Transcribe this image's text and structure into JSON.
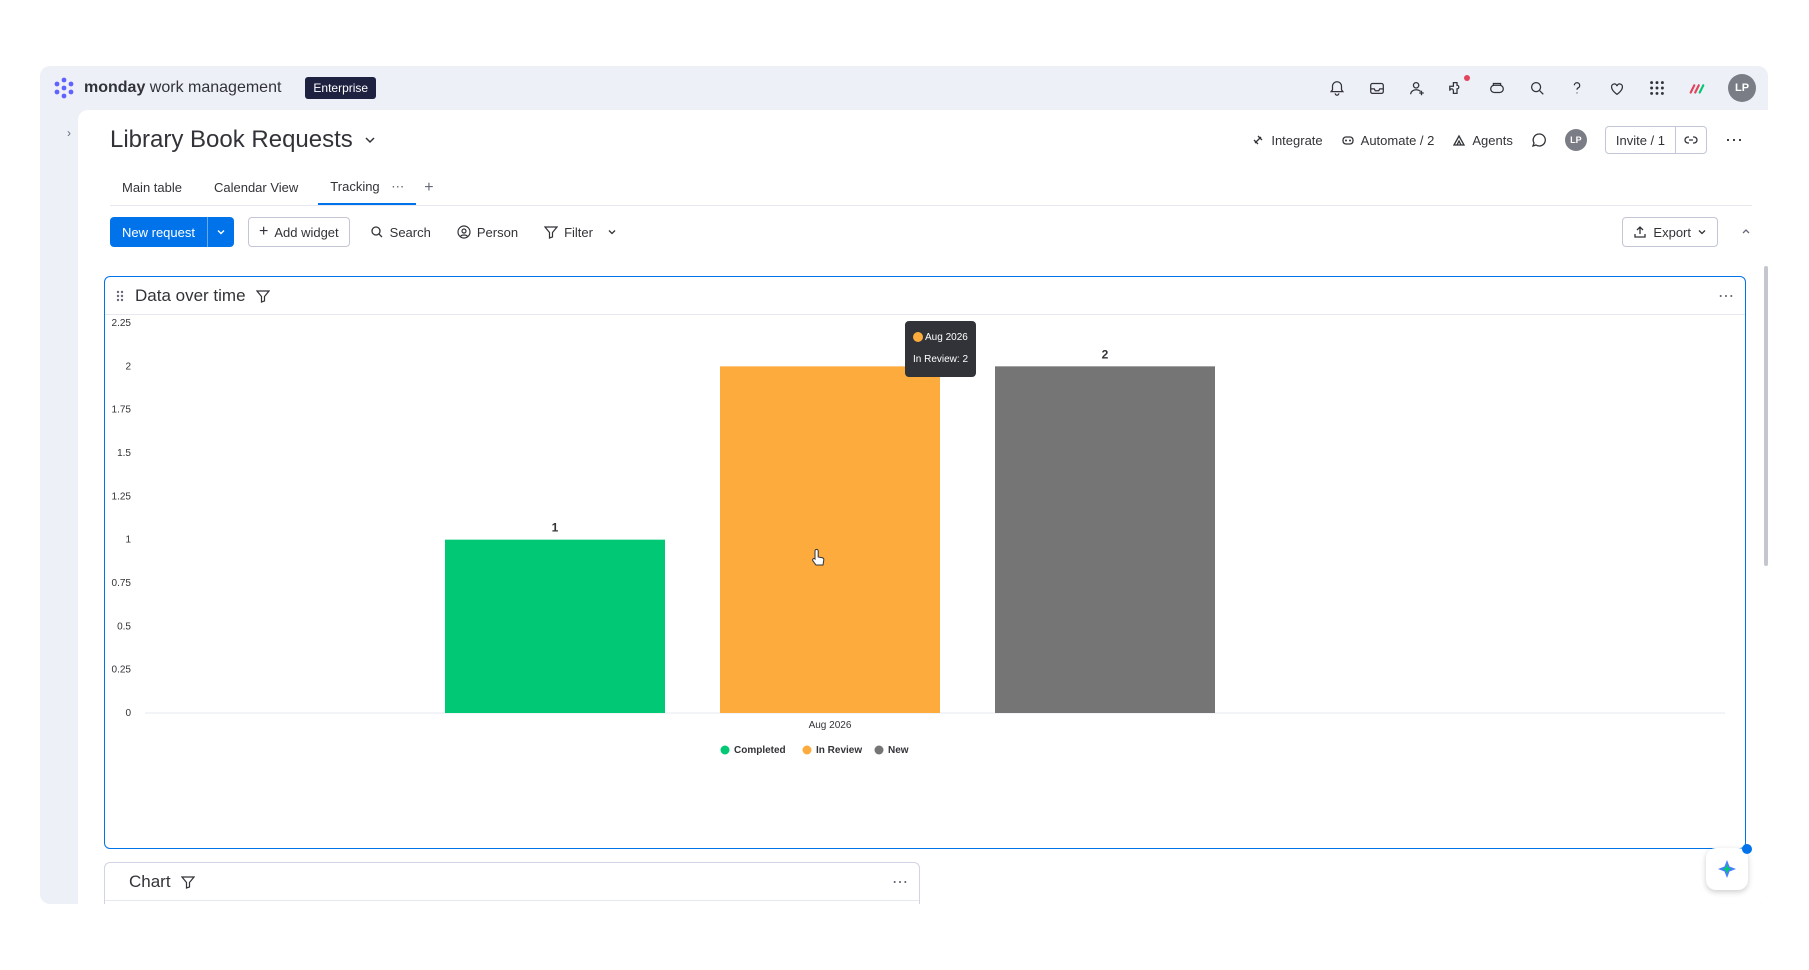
{
  "app": {
    "brand_bold": "monday",
    "brand_rest": " work management",
    "plan": "Enterprise",
    "user_initials": "LP"
  },
  "top_icons": [
    "bell-icon",
    "inbox-icon",
    "invite-members-icon",
    "apps-icon",
    "search-everything-icon",
    "search-icon",
    "help-icon",
    "heart-icon",
    "grid-menu-icon",
    "product-switcher-icon"
  ],
  "board": {
    "title": "Library Book Requests",
    "integrate": "Integrate",
    "automate": "Automate / 2",
    "agents": "Agents",
    "invite": "Invite / 1"
  },
  "views": [
    "Main table",
    "Calendar View",
    "Tracking"
  ],
  "toolbar": {
    "new_request": "New request",
    "add_widget": "Add widget",
    "search": "Search",
    "person": "Person",
    "filter": "Filter",
    "export": "Export"
  },
  "widgets": {
    "data_over_time": "Data over time",
    "chart": "Chart"
  },
  "tooltip": {
    "period": "Aug 2026",
    "text": "In Review: 2"
  },
  "colors": {
    "completed": "#00c875",
    "in_review": "#fdab3d",
    "new": "#757575",
    "accent": "#0073ea"
  },
  "chart_data": {
    "type": "bar",
    "categories": [
      "Aug 2026"
    ],
    "series": [
      {
        "name": "Completed",
        "values": [
          1
        ]
      },
      {
        "name": "In Review",
        "values": [
          2
        ]
      },
      {
        "name": "New",
        "values": [
          2
        ]
      }
    ],
    "yticks": [
      "0",
      "0.25",
      "0.5",
      "0.75",
      "1",
      "1.25",
      "1.5",
      "1.75",
      "2",
      "2.25"
    ],
    "ylim": [
      0,
      2.25
    ],
    "data_labels": [
      "1",
      "",
      "2"
    ],
    "legend_position": "bottom",
    "grid": false
  }
}
